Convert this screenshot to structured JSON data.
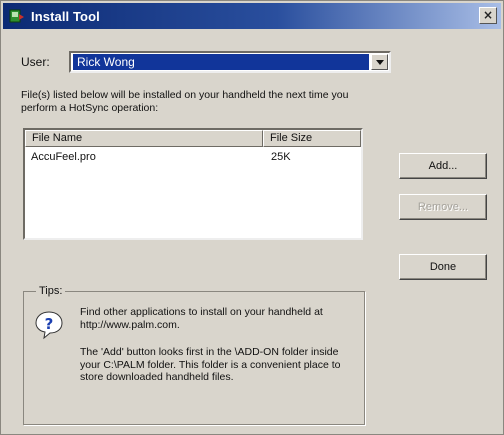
{
  "window": {
    "title": "Install Tool",
    "close_glyph": "×"
  },
  "user": {
    "label": "User:",
    "value": "Rick Wong"
  },
  "info_text": "File(s) listed below will be installed on your handheld the next time you perform a HotSync operation:",
  "file_list": {
    "columns": [
      "File Name",
      "File Size"
    ],
    "rows": [
      [
        "AccuFeel.pro",
        "25K"
      ]
    ]
  },
  "buttons": {
    "add": "Add...",
    "remove": "Remove...",
    "done": "Done"
  },
  "tips": {
    "legend": "Tips:",
    "icon": "question-icon",
    "text1": "Find other applications to install on your handheld at http://www.palm.com.",
    "text2": "The 'Add' button looks first in the \\ADD-ON folder inside your C:\\PALM folder. This folder is a convenient place to store downloaded handheld files."
  },
  "colors": {
    "title_bar": "#0c2a74",
    "selection": "#11359a",
    "window_bg": "#d9d5cc"
  }
}
